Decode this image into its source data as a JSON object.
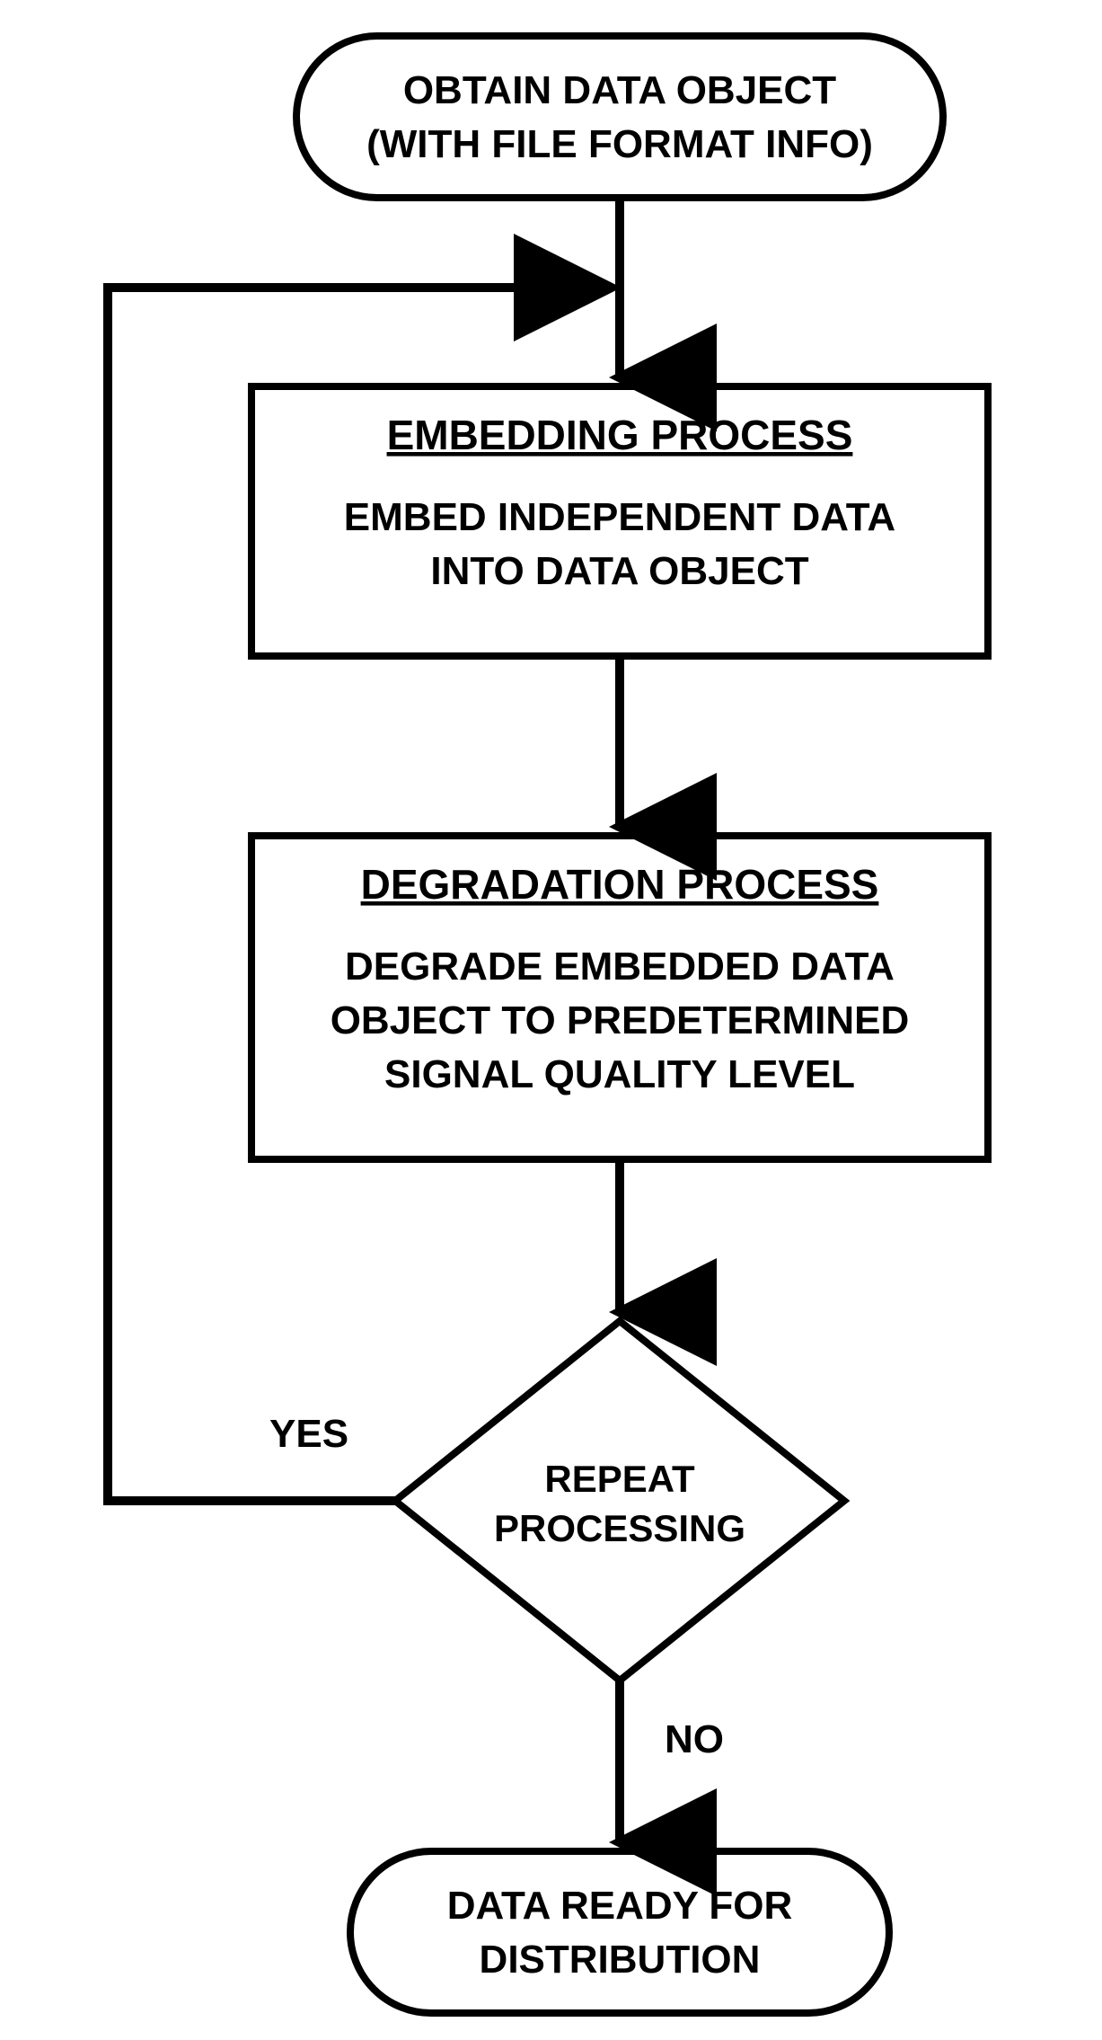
{
  "chart_data": {
    "type": "flowchart",
    "nodes": [
      {
        "id": "start",
        "shape": "oval",
        "lines": [
          "OBTAIN DATA OBJECT",
          "(WITH FILE FORMAT INFO)"
        ]
      },
      {
        "id": "embed",
        "shape": "process",
        "title": "EMBEDDING PROCESS",
        "body": [
          "EMBED INDEPENDENT DATA",
          "INTO DATA OBJECT"
        ]
      },
      {
        "id": "degrade",
        "shape": "process",
        "title": "DEGRADATION PROCESS",
        "body": [
          "DEGRADE EMBEDDED DATA",
          "OBJECT TO PREDETERMINED",
          "SIGNAL QUALITY LEVEL"
        ]
      },
      {
        "id": "decision",
        "shape": "diamond",
        "lines": [
          "REPEAT",
          "PROCESSING"
        ]
      },
      {
        "id": "end",
        "shape": "oval",
        "lines": [
          "DATA READY FOR",
          "DISTRIBUTION"
        ]
      }
    ],
    "edges": [
      {
        "from": "start",
        "to": "embed"
      },
      {
        "from": "embed",
        "to": "degrade"
      },
      {
        "from": "degrade",
        "to": "decision"
      },
      {
        "from": "decision",
        "to": "embed",
        "label": "YES"
      },
      {
        "from": "decision",
        "to": "end",
        "label": "NO"
      }
    ]
  }
}
